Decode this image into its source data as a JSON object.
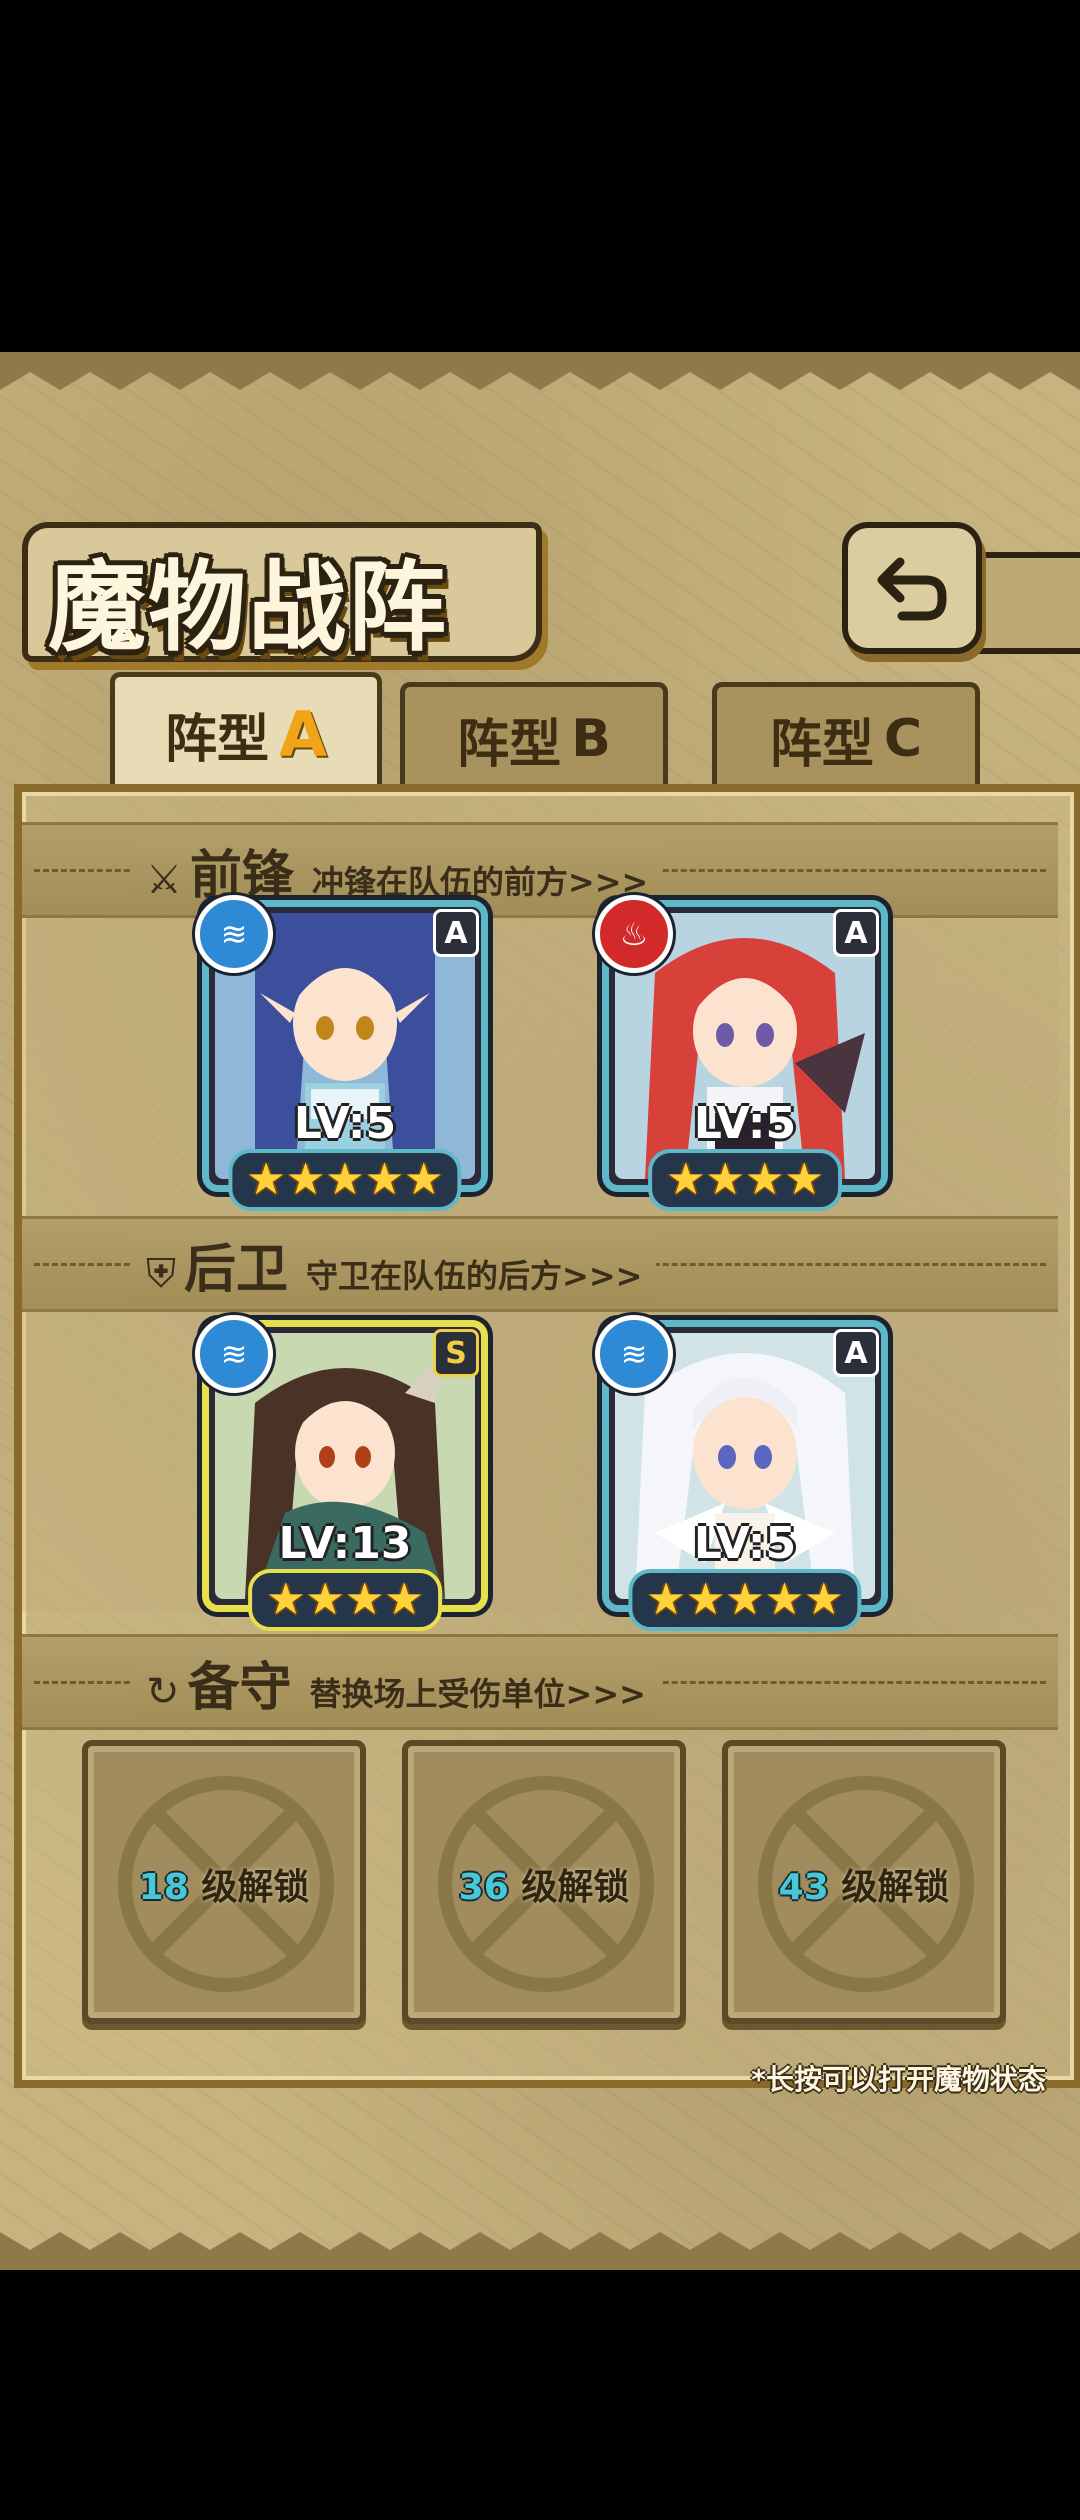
{
  "header": {
    "title": "魔物战阵",
    "back_icon": "return-arrow-icon"
  },
  "tabs": [
    {
      "label": "阵型",
      "letter": "A",
      "active": true
    },
    {
      "label": "阵型",
      "letter": "B",
      "active": false
    },
    {
      "label": "阵型",
      "letter": "C",
      "active": false
    }
  ],
  "sections": {
    "front": {
      "icon": "sword-icon",
      "title": "前锋",
      "desc": "冲锋在队伍的前方>>>"
    },
    "rear": {
      "icon": "shield-icon",
      "title": "后卫",
      "desc": "守卫在队伍的后方>>>"
    },
    "reserve": {
      "icon": "swap-icon",
      "title": "备守",
      "desc": "替换场上受伤单位>>>"
    }
  },
  "monsters": {
    "front_1": {
      "element": "water",
      "rank": "A",
      "level": "LV:5",
      "stars": "★★★★★"
    },
    "front_2": {
      "element": "fire",
      "rank": "A",
      "level": "LV:5",
      "stars": "★★★★"
    },
    "rear_1": {
      "element": "water",
      "rank": "S",
      "level": "LV:13",
      "stars": "★★★★"
    },
    "rear_2": {
      "element": "water",
      "rank": "A",
      "level": "LV:5",
      "stars": "★★★★★"
    }
  },
  "reserve_slots": [
    {
      "num": "18",
      "text": "级解锁"
    },
    {
      "num": "36",
      "text": "级解锁"
    },
    {
      "num": "43",
      "text": "级解锁"
    }
  ],
  "hint": "*长按可以打开魔物状态",
  "colors": {
    "accent": "#f0a418",
    "water": "#2f8ad6",
    "fire": "#d22a2a",
    "card_border": "#5fb8c8",
    "rank_s_border": "#e8e04a"
  }
}
